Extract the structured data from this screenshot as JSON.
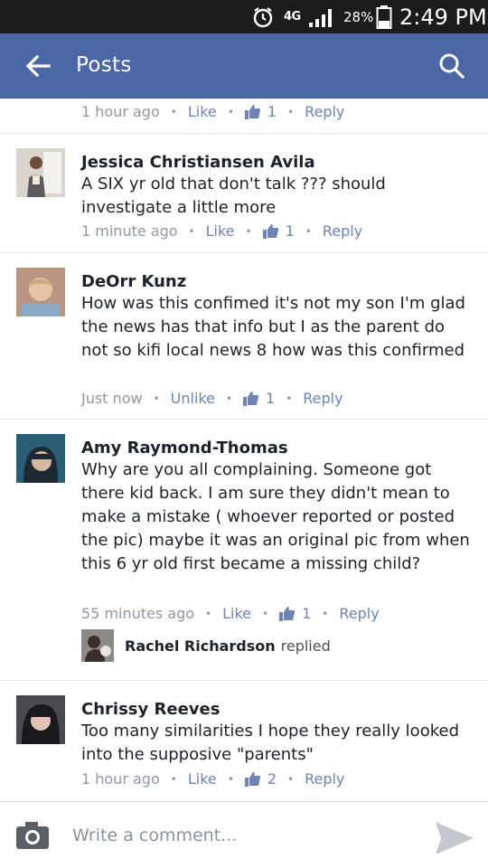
{
  "status_bar": {
    "network": "4G",
    "battery": "28%",
    "time": "2:49 PM",
    "icons": [
      "alarm-icon",
      "signal-icon",
      "battery-icon"
    ]
  },
  "header": {
    "title": "Posts",
    "back_icon": "arrow-left-icon",
    "search_icon": "search-icon",
    "color": "#4b67a5"
  },
  "actions": {
    "like": "Like",
    "unlike": "Unlike",
    "reply": "Reply",
    "separator": "•"
  },
  "partial_comment": {
    "time": "1 hour ago",
    "action": "Like",
    "likes": "1"
  },
  "comments": [
    {
      "name": "Jessica Christiansen Avila",
      "text": "A SIX yr old that don't talk ??? should investigate a little more",
      "time": "1 minute ago",
      "action": "Like",
      "likes": "1"
    },
    {
      "name": "DeOrr Kunz",
      "text": "How was this confimed it's not my son I'm glad the news has that info but I as the parent do not so kifi local news 8 how was this confirmed",
      "time": "Just now",
      "action": "Unlike",
      "likes": "1"
    },
    {
      "name": "Amy Raymond-Thomas",
      "text": "Why are you all complaining. Someone got there kid back. I am sure they didn't mean to make a mistake ( whoever reported or posted the pic) maybe it was an original pic from when this 6 yr old first became a missing child?",
      "time": "55 minutes ago",
      "action": "Like",
      "likes": "1",
      "reply_preview": {
        "name": "Rachel Richardson",
        "verb": "replied"
      }
    },
    {
      "name": "Chrissy Reeves",
      "text": "Too many similarities I hope they really looked into the supposive \"parents\"",
      "time": "1 hour ago",
      "action": "Like",
      "likes": "2"
    }
  ],
  "composer": {
    "placeholder": "Write a comment...",
    "camera_icon": "camera-icon",
    "send_icon": "send-icon"
  },
  "colors": {
    "accent": "#4b67a5",
    "link": "#6d84b4",
    "meta": "#9197a3",
    "text": "#1d2129"
  }
}
